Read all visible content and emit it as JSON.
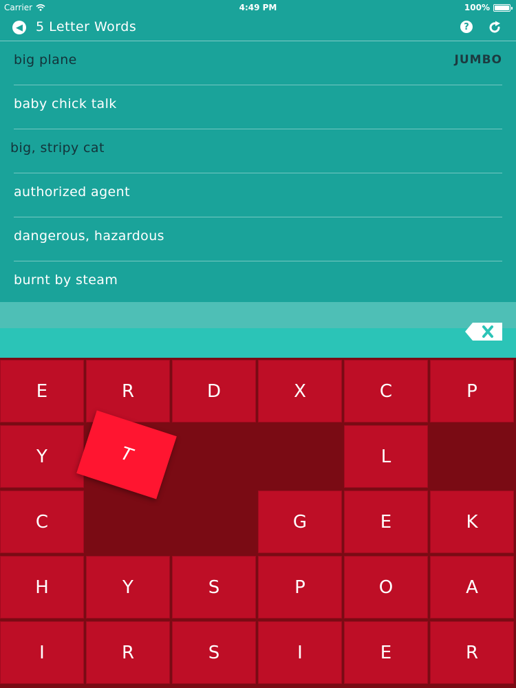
{
  "status": {
    "carrier": "Carrier",
    "time": "4:49 PM",
    "battery": "100%"
  },
  "nav": {
    "title": "5 Letter Words"
  },
  "clues": [
    {
      "text": "big plane",
      "answer": "JUMBO"
    },
    {
      "text": "baby chick talk",
      "answer": ""
    },
    {
      "text": "big, stripy cat",
      "answer": ""
    },
    {
      "text": "authorized agent",
      "answer": ""
    },
    {
      "text": "dangerous, hazardous",
      "answer": ""
    },
    {
      "text": "burnt by steam",
      "answer": ""
    }
  ],
  "grid": {
    "rows": [
      [
        "E",
        "R",
        "D",
        "X",
        "C",
        "P"
      ],
      [
        "Y",
        "",
        "",
        "",
        "L",
        ""
      ],
      [
        "C",
        "",
        "",
        "G",
        "E",
        "K"
      ],
      [
        "H",
        "Y",
        "S",
        "P",
        "O",
        "A"
      ],
      [
        "I",
        "R",
        "S",
        "I",
        "E",
        "R"
      ]
    ],
    "dragged_letter": "T"
  },
  "colors": {
    "teal": "#1aa39a",
    "tile": "#be0e26",
    "tile_active": "#ff1530",
    "grid_bg": "#7a0b14"
  }
}
